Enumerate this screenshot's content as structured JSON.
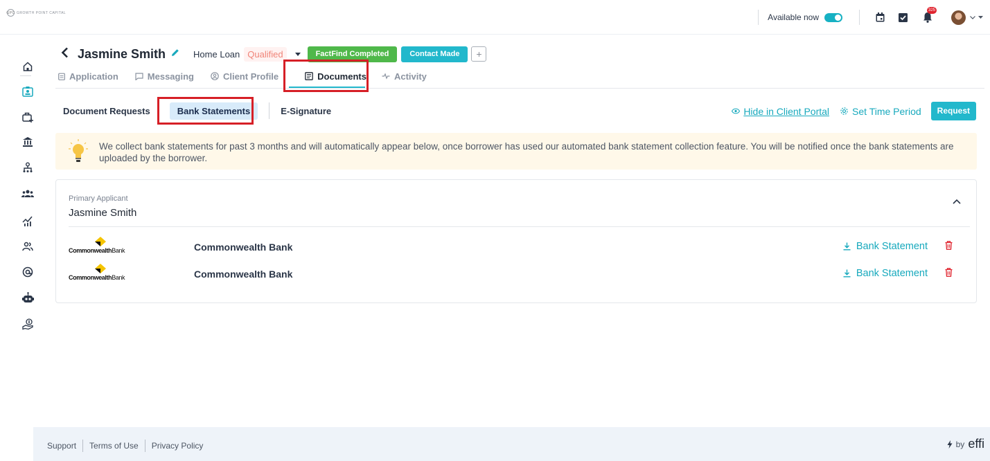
{
  "topbar": {
    "logo_text": "GROWTH POINT CAPITAL",
    "logo_mark": "GPC",
    "available_label": "Available now",
    "notification_count": "325"
  },
  "header": {
    "client_name": "Jasmine Smith",
    "loan_type": "Home Loan",
    "status": "Qualified",
    "tag_factfind": "FactFind Completed",
    "tag_contact": "Contact Made",
    "add_label": "+"
  },
  "tabs": [
    {
      "label": "Application"
    },
    {
      "label": "Messaging"
    },
    {
      "label": "Client Profile"
    },
    {
      "label": "Documents"
    },
    {
      "label": "Activity"
    }
  ],
  "subtabs": [
    {
      "label": "Document Requests"
    },
    {
      "label": "Bank Statements"
    },
    {
      "label": "E-Signature"
    }
  ],
  "actions": {
    "hide_portal": "Hide in Client Portal",
    "set_period": "Set Time Period",
    "request": "Request"
  },
  "banner": {
    "text": "We collect bank statements for past 3 months and will automatically appear below, once borrower has used our automated bank statement collection feature. You will be notified once the bank statements are uploaded by the borrower."
  },
  "applicant": {
    "role_label": "Primary Applicant",
    "name": "Jasmine Smith",
    "banks": [
      {
        "logo_word": "Commonwealth",
        "logo_suffix": "Bank",
        "name": "Commonwealth Bank",
        "download_label": "Bank Statement"
      },
      {
        "logo_word": "Commonwealth",
        "logo_suffix": "Bank",
        "name": "Commonwealth Bank",
        "download_label": "Bank Statement"
      }
    ]
  },
  "footer": {
    "support": "Support",
    "terms": "Terms of Use",
    "privacy": "Privacy Policy",
    "by_label": "by",
    "brand": "effi"
  },
  "colors": {
    "accent": "#22b8cc",
    "factfind": "#4fb84a",
    "qualified": "#f08478",
    "highlight_box": "#d61f26",
    "danger": "#e0242f"
  }
}
